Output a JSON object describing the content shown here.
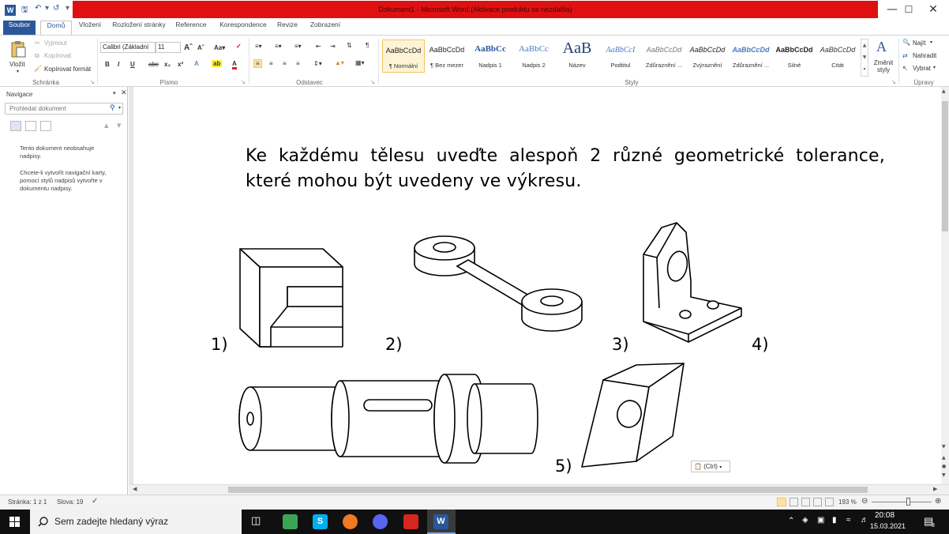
{
  "window": {
    "title": "Dokument1 - Microsoft Word (Aktivace produktu se nezdařila)"
  },
  "tabs": [
    "Soubor",
    "Domů",
    "Vložení",
    "Rozložení stránky",
    "Reference",
    "Korespondence",
    "Revize",
    "Zobrazení"
  ],
  "ribbon": {
    "clipboard": {
      "paste": "Vložit",
      "cut": "Vyjmout",
      "copy": "Kopírovat",
      "format_painter": "Kopírovat formát",
      "label": "Schránka"
    },
    "font": {
      "name": "Calibri (Základní",
      "size": "11",
      "label": "Písmo"
    },
    "paragraph": {
      "label": "Odstavec"
    },
    "styles": {
      "label": "Styly",
      "items": [
        {
          "preview": "AaBbCcDd",
          "name": "¶ Normální"
        },
        {
          "preview": "AaBbCcDd",
          "name": "¶ Bez mezer"
        },
        {
          "preview": "AaBbCc",
          "name": "Nadpis 1"
        },
        {
          "preview": "AaBbCc",
          "name": "Nadpis 2"
        },
        {
          "preview": "AaB",
          "name": "Název"
        },
        {
          "preview": "AaBbCcI",
          "name": "Podtitul"
        },
        {
          "preview": "AaBbCcDd",
          "name": "Zdůraznění ..."
        },
        {
          "preview": "AaBbCcDd",
          "name": "Zvýraznění"
        },
        {
          "preview": "AaBbCcDd",
          "name": "Zdůraznění ..."
        },
        {
          "preview": "AaBbCcDd",
          "name": "Silné"
        },
        {
          "preview": "AaBbCcDd",
          "name": "Citát"
        }
      ],
      "change": "Změnit styly"
    },
    "editing": {
      "find": "Najít",
      "replace": "Nahradit",
      "select": "Vybrat",
      "label": "Úpravy"
    }
  },
  "navigation": {
    "title": "Navigace",
    "search_placeholder": "Prohledat dokument",
    "message1": "Tento dokument neobsahuje nadpisy.",
    "message2": "Chcete-li vytvořit navigační karty, pomocí stylů nadpisů vytvořte v dokumentu nadpisy."
  },
  "document": {
    "heading": "Ke každému tělesu uveďte alespoň 2 různé geometrické tolerance, které mohou být uvedeny ve výkresu.",
    "labels": [
      "1)",
      "2)",
      "3)",
      "4)",
      "5)"
    ],
    "paste_options": "(Ctrl)"
  },
  "status": {
    "page": "Stránka: 1 z 1",
    "words": "Slova: 19",
    "zoom": "193 %"
  },
  "taskbar": {
    "search_placeholder": "Sem zadejte hledaný výraz",
    "time": "20:08",
    "date": "15.03.2021",
    "notifications": "8"
  },
  "colors": {
    "title_highlight": "#e01010",
    "word_blue": "#2b579a",
    "taskbar": "#101010"
  }
}
